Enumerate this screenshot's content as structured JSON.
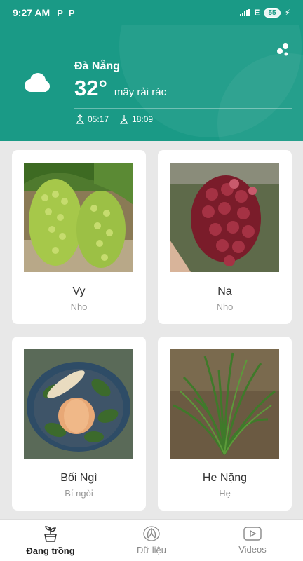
{
  "status_bar": {
    "time": "9:27 AM",
    "network": "E",
    "battery": "55"
  },
  "weather": {
    "city": "Đà Nẵng",
    "temperature": "32°",
    "condition": "mây rải rác",
    "sunrise": "05:17",
    "sunset": "18:09"
  },
  "plants": [
    {
      "name": "Vy",
      "type": "Nho"
    },
    {
      "name": "Na",
      "type": "Nho"
    },
    {
      "name": "Bối Ngì",
      "type": "Bí ngòi"
    },
    {
      "name": "He Nặng",
      "type": "Hẹ"
    }
  ],
  "nav": {
    "items": [
      {
        "label": "Đang trồng",
        "icon": "pot-plant-icon",
        "active": true
      },
      {
        "label": "Dữ liệu",
        "icon": "leaves-icon",
        "active": false
      },
      {
        "label": "Videos",
        "icon": "play-icon",
        "active": false
      }
    ]
  },
  "colors": {
    "primary": "#1a9a86",
    "background": "#e8e8e8"
  }
}
